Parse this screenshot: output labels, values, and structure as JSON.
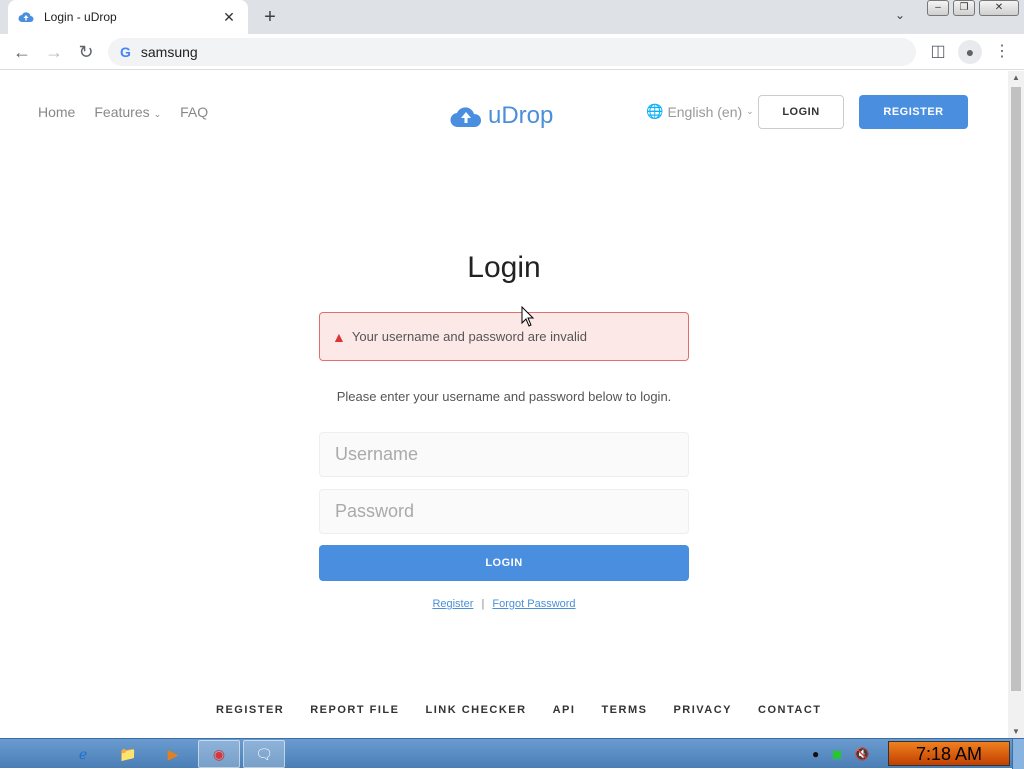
{
  "browser": {
    "tab_title": "Login - uDrop",
    "tab_close": "✕",
    "new_tab": "+",
    "url": "samsung",
    "google_mark": "G"
  },
  "site": {
    "nav": [
      {
        "label": "Home"
      },
      {
        "label": "Features"
      },
      {
        "label": "FAQ"
      }
    ],
    "brand": "uDrop",
    "language": "English (en)",
    "login_top": "LOGIN",
    "register_top": "REGISTER"
  },
  "login": {
    "heading": "Login",
    "error": "Your username and password are invalid",
    "instructions": "Please enter your username and password below to login.",
    "username_placeholder": "Username",
    "password_placeholder": "Password",
    "submit": "LOGIN",
    "register_link": "Register",
    "separator": "|",
    "forgot_link": "Forgot Password"
  },
  "footer": [
    "REGISTER",
    "REPORT FILE",
    "LINK CHECKER",
    "API",
    "TERMS",
    "PRIVACY",
    "CONTACT"
  ],
  "taskbar": {
    "clock": "7:18 AM"
  },
  "colors": {
    "brand_blue": "#4a8fdf",
    "alert_bg": "#fde8e8",
    "alert_border": "#e07070"
  }
}
